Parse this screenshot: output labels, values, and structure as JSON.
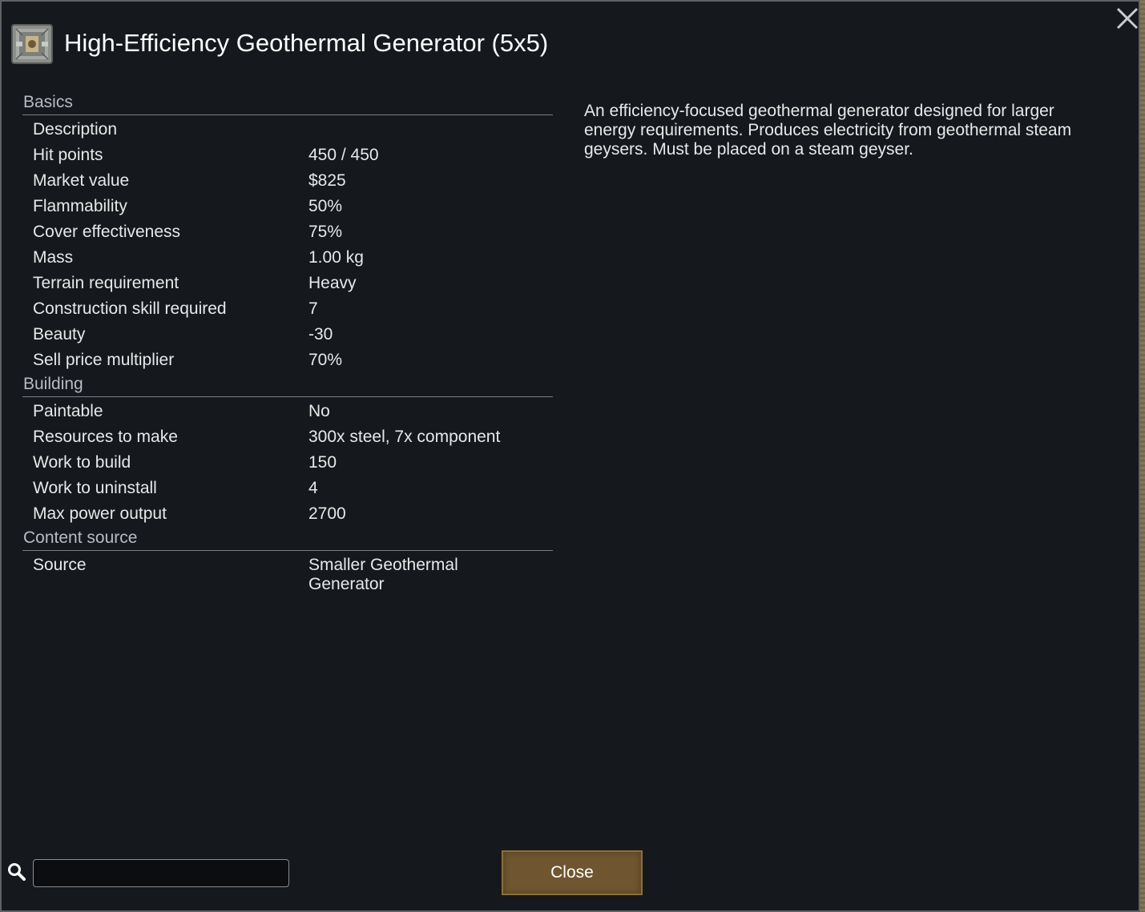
{
  "window": {
    "title": "High-Efficiency Geothermal Generator (5x5)",
    "title_icon": "geothermal-generator-icon",
    "close_icon": "close-icon"
  },
  "sections": [
    {
      "header": "Basics",
      "rows": [
        {
          "label": "Description",
          "value": ""
        },
        {
          "label": "Hit points",
          "value": "450 / 450"
        },
        {
          "label": "Market value",
          "value": "$825"
        },
        {
          "label": "Flammability",
          "value": "50%"
        },
        {
          "label": "Cover effectiveness",
          "value": "75%"
        },
        {
          "label": "Mass",
          "value": "1.00 kg"
        },
        {
          "label": "Terrain requirement",
          "value": "Heavy"
        },
        {
          "label": "Construction skill required",
          "value": "7"
        },
        {
          "label": "Beauty",
          "value": "-30"
        },
        {
          "label": "Sell price multiplier",
          "value": "70%"
        }
      ]
    },
    {
      "header": "Building",
      "rows": [
        {
          "label": "Paintable",
          "value": "No"
        },
        {
          "label": "Resources to make",
          "value": "300x steel, 7x component"
        },
        {
          "label": "Work to build",
          "value": "150"
        },
        {
          "label": "Work to uninstall",
          "value": "4"
        },
        {
          "label": "Max power output",
          "value": "2700"
        }
      ]
    },
    {
      "header": "Content source",
      "rows": [
        {
          "label": "Source",
          "value": "Smaller Geothermal Generator"
        }
      ]
    }
  ],
  "description": "An efficiency-focused geothermal generator designed for larger energy requirements. Produces electricity from geothermal steam geysers. Must be placed on a steam geyser.",
  "search": {
    "icon": "search-icon",
    "value": "",
    "placeholder": ""
  },
  "footer": {
    "close_label": "Close"
  },
  "colors": {
    "background": "#15191e",
    "text": "#e8e8e8",
    "section_header": "#b8bcc2",
    "button": "#6f5630"
  }
}
